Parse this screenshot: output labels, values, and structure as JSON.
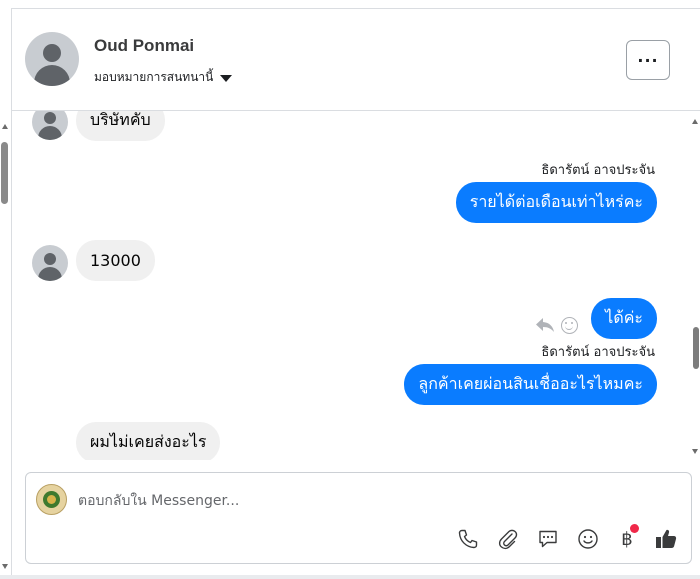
{
  "header": {
    "name": "Oud Ponmai",
    "assign_label": "มอบหมายการสนทนานี้",
    "more_label": "···"
  },
  "messages": [
    {
      "direction": "in",
      "text": "บริษัทคับ"
    },
    {
      "direction": "out",
      "sender": "ธิดารัตน์ อาจประจัน",
      "text": "รายได้ต่อเดือนเท่าไหร่คะ"
    },
    {
      "direction": "in",
      "text": "13000"
    },
    {
      "direction": "out",
      "text": "ได้ค่ะ"
    },
    {
      "direction": "out",
      "sender": "ธิดารัตน์ อาจประจัน",
      "text": "ลูกค้าเคยผ่อนสินเชื่ออะไรไหมคะ"
    },
    {
      "direction": "in",
      "text": "ผมไม่เคยส่งอะไร"
    }
  ],
  "composer": {
    "placeholder": "ตอบกลับใน Messenger..."
  },
  "toolbar_icons": [
    "phone-icon",
    "paperclip-icon",
    "speech-bubble-icon",
    "emoji-icon",
    "baht-icon",
    "thumbs-up-icon"
  ],
  "toolbar_labels": {
    "baht": "฿"
  },
  "colors": {
    "outgoing_bubble": "#0a7cff",
    "incoming_bubble": "#f0f0f0",
    "notification_dot": "#f02849"
  }
}
